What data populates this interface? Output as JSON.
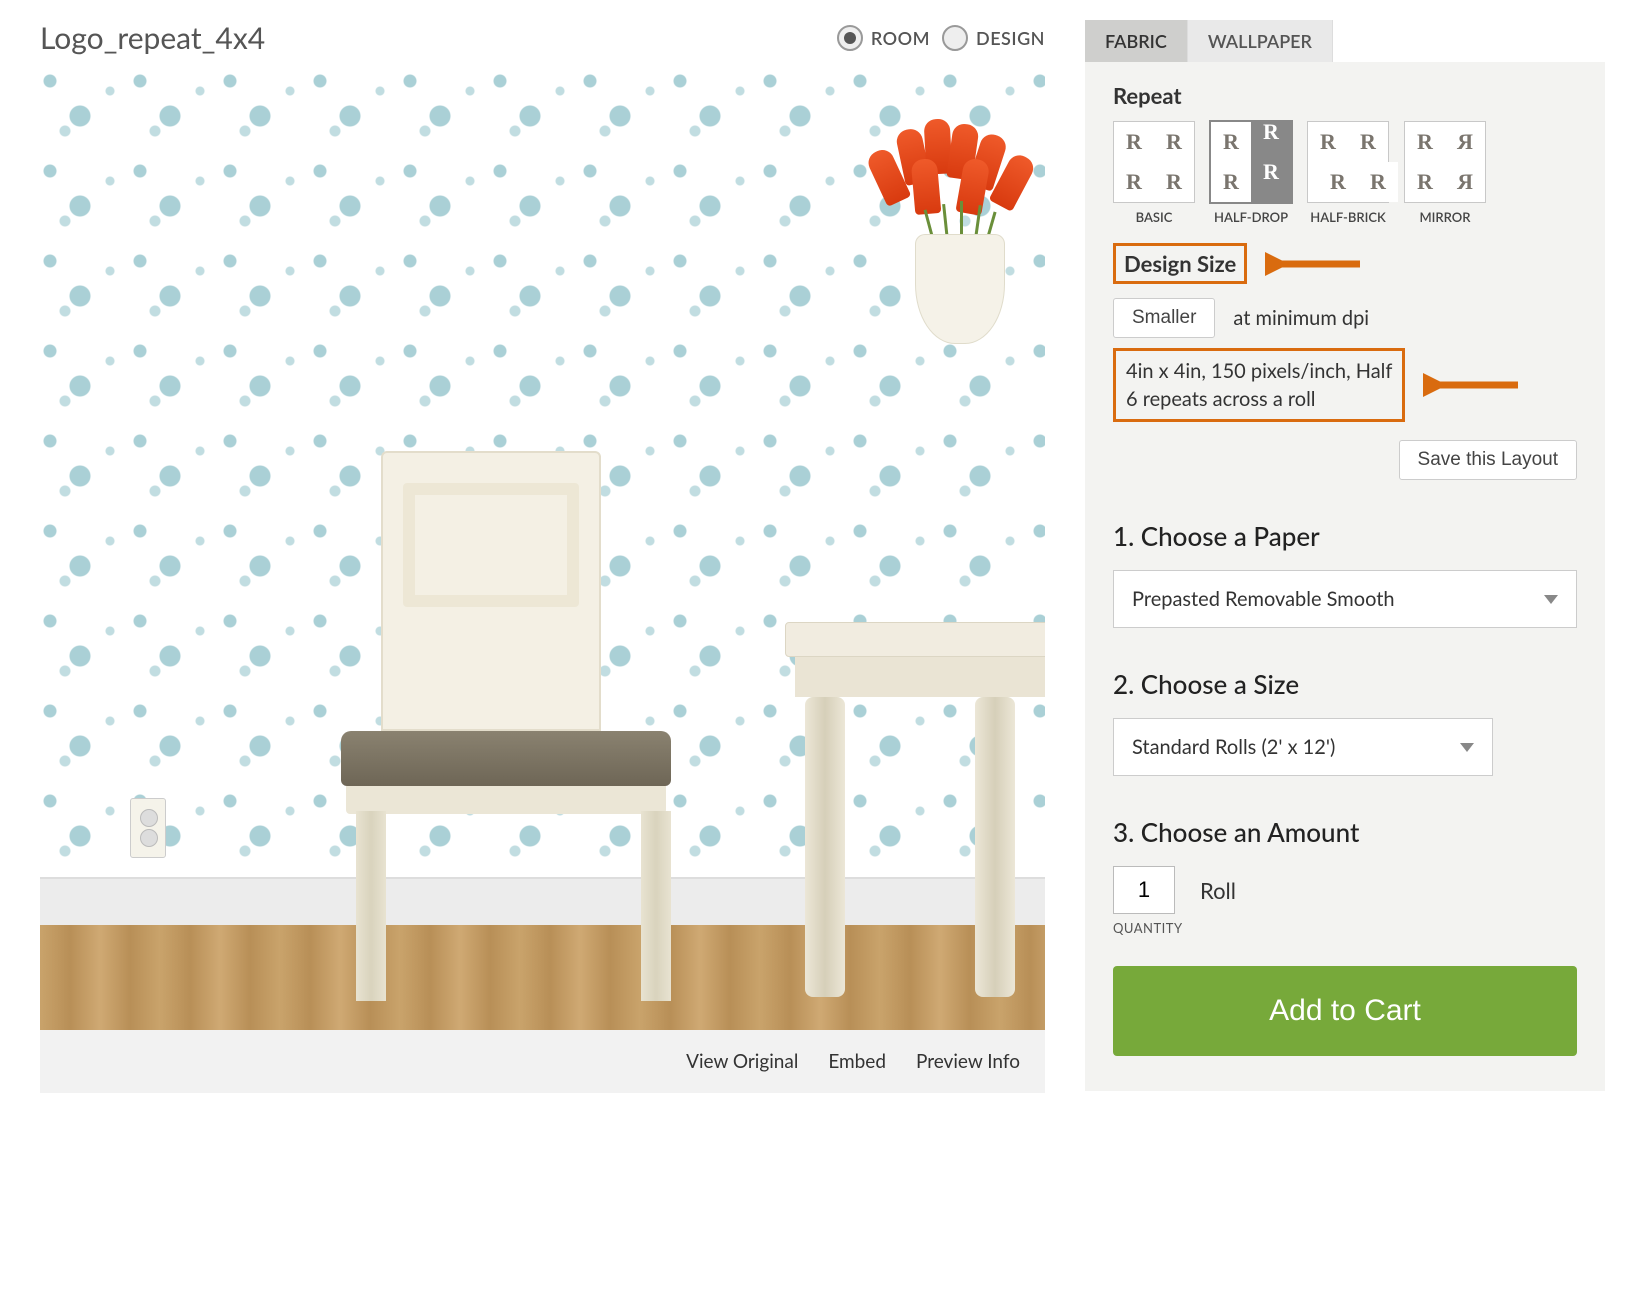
{
  "product": {
    "title": "Logo_repeat_4x4"
  },
  "viewToggle": {
    "room": "ROOM",
    "design": "DESIGN",
    "selected": "room"
  },
  "previewLinks": {
    "viewOriginal": "View Original",
    "embed": "Embed",
    "previewInfo": "Preview Info"
  },
  "tabs": {
    "fabric": "FABRIC",
    "wallpaper": "WALLPAPER",
    "active": "fabric"
  },
  "repeat": {
    "heading": "Repeat",
    "options": [
      {
        "key": "basic",
        "label": "BASIC"
      },
      {
        "key": "half-drop",
        "label": "HALF-DROP"
      },
      {
        "key": "half-brick",
        "label": "HALF-BRICK"
      },
      {
        "key": "mirror",
        "label": "MIRROR"
      }
    ],
    "selected": "half-drop"
  },
  "designSize": {
    "label": "Design Size",
    "smaller": "Smaller",
    "dpiNote": "at minimum dpi",
    "infoLine1": "4in x 4in, 150 pixels/inch, Half",
    "infoLine2": "6 repeats across a roll",
    "saveLayout": "Save this Layout"
  },
  "steps": {
    "paper": {
      "heading": "1. Choose a Paper",
      "value": "Prepasted Removable Smooth"
    },
    "size": {
      "heading": "2. Choose a Size",
      "value": "Standard Rolls (2' x 12')"
    },
    "amount": {
      "heading": "3. Choose an Amount",
      "quantity": "1",
      "unit": "Roll",
      "caption": "QUANTITY"
    }
  },
  "addToCart": "Add to Cart"
}
